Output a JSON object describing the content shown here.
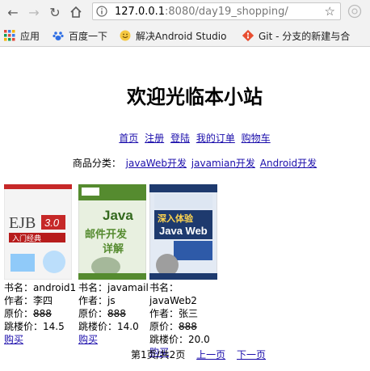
{
  "browser": {
    "url_host": "127.0.0.1",
    "url_path": ":8080/day19_shopping/"
  },
  "bookmarks": [
    {
      "label": "应用",
      "icon": "apps-grid-icon"
    },
    {
      "label": "百度一下",
      "icon": "baidu-paw-icon"
    },
    {
      "label": "解决Android Studio",
      "icon": "studio-icon"
    },
    {
      "label": "Git - 分支的新建与合",
      "icon": "git-icon"
    }
  ],
  "page": {
    "title": "欢迎光临本小站",
    "menu": [
      "首页",
      "注册",
      "登陆",
      "我的订单",
      "购物车"
    ],
    "category_label": "商品分类：",
    "categories": [
      "javaWeb开发",
      "javamian开发",
      "Android开发"
    ]
  },
  "products": [
    {
      "name_label": "书名：android1",
      "author_label": "作者：李四",
      "price_prefix": "原价：",
      "price": "888",
      "sale_label": "跳楼价：14.5",
      "buy": "购买",
      "cover_text": "EJB 3.0 入门经典"
    },
    {
      "name_label": "书名：javamail",
      "author_label": "作者：js",
      "price_prefix": "原价：",
      "price": "888",
      "sale_label": "跳楼价：14.0",
      "buy": "购买",
      "cover_text": "Java 邮件开发详解"
    },
    {
      "name_label": "书名：javaWeb2",
      "author_label": "作者：张三",
      "price_prefix": "原价：",
      "price": "888",
      "sale_label": "跳楼价：20.0",
      "buy": "购买",
      "cover_text": "深入体验 Java Web 开发内幕 高级特性"
    }
  ],
  "pager": {
    "status": "第1页/共2页",
    "prev": "上一页",
    "next": "下一页"
  }
}
